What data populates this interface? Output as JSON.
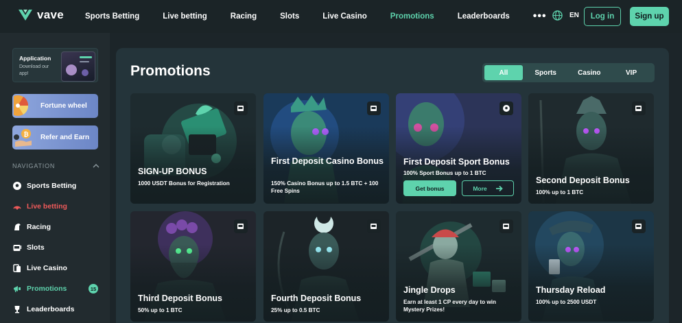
{
  "header": {
    "logo_text": "vave",
    "nav": [
      "Sports Betting",
      "Live betting",
      "Racing",
      "Slots",
      "Live Casino",
      "Promotions",
      "Leaderboards"
    ],
    "more": "•••",
    "lang": "EN",
    "login": "Log in",
    "signup": "Sign up",
    "accent_color": "#5ed3ad"
  },
  "sidebar": {
    "app": {
      "title": "Application",
      "subtitle": "Download our app!"
    },
    "tiles": [
      {
        "label": "Fortune wheel",
        "icon": "fortune-wheel-icon"
      },
      {
        "label": "Refer and Earn",
        "icon": "bitcoin-hand-icon"
      }
    ],
    "nav_heading": "NAVIGATION",
    "items": [
      {
        "label": "Sports Betting",
        "icon": "soccer-ball-icon"
      },
      {
        "label": "Live betting",
        "icon": "live-signal-icon"
      },
      {
        "label": "Racing",
        "icon": "horse-icon"
      },
      {
        "label": "Slots",
        "icon": "slot-machine-icon"
      },
      {
        "label": "Live Casino",
        "icon": "cards-icon"
      },
      {
        "label": "Promotions",
        "icon": "promotions-icon",
        "badge": "15"
      },
      {
        "label": "Leaderboards",
        "icon": "trophy-icon"
      }
    ]
  },
  "main": {
    "title": "Promotions",
    "filters": [
      "All",
      "Sports",
      "Casino",
      "VIP"
    ],
    "active_filter": "All",
    "cards": [
      {
        "title": "SIGN-UP BONUS",
        "subtitle": "1000 USDT Bonus for Registration",
        "type_icon": "casino-icon"
      },
      {
        "title": "First Deposit Casino Bonus",
        "subtitle": "150% Casino Bonus up to 1.5 BTC + 100 Free Spins",
        "type_icon": "casino-icon"
      },
      {
        "title": "First Deposit Sport Bonus",
        "subtitle": "100% Sport Bonus up to 1 BTC",
        "type_icon": "soccer-ball-icon",
        "get_label": "Get bonus",
        "more_label": "More"
      },
      {
        "title": "Second Deposit Bonus",
        "subtitle": "100% up to 1 BTC",
        "type_icon": "casino-icon"
      },
      {
        "title": "Third Deposit Bonus",
        "subtitle": "50% up to 1 BTC",
        "type_icon": "casino-icon"
      },
      {
        "title": "Fourth Deposit Bonus",
        "subtitle": "25% up to 0.5 BTC",
        "type_icon": "casino-icon"
      },
      {
        "title": "Jingle Drops",
        "subtitle": "Earn at least 1 CP every day to win Mystery Prizes!",
        "type_icon": "casino-icon"
      },
      {
        "title": "Thursday Reload",
        "subtitle": "100% up to 2500 USDT",
        "type_icon": "casino-icon"
      }
    ]
  }
}
